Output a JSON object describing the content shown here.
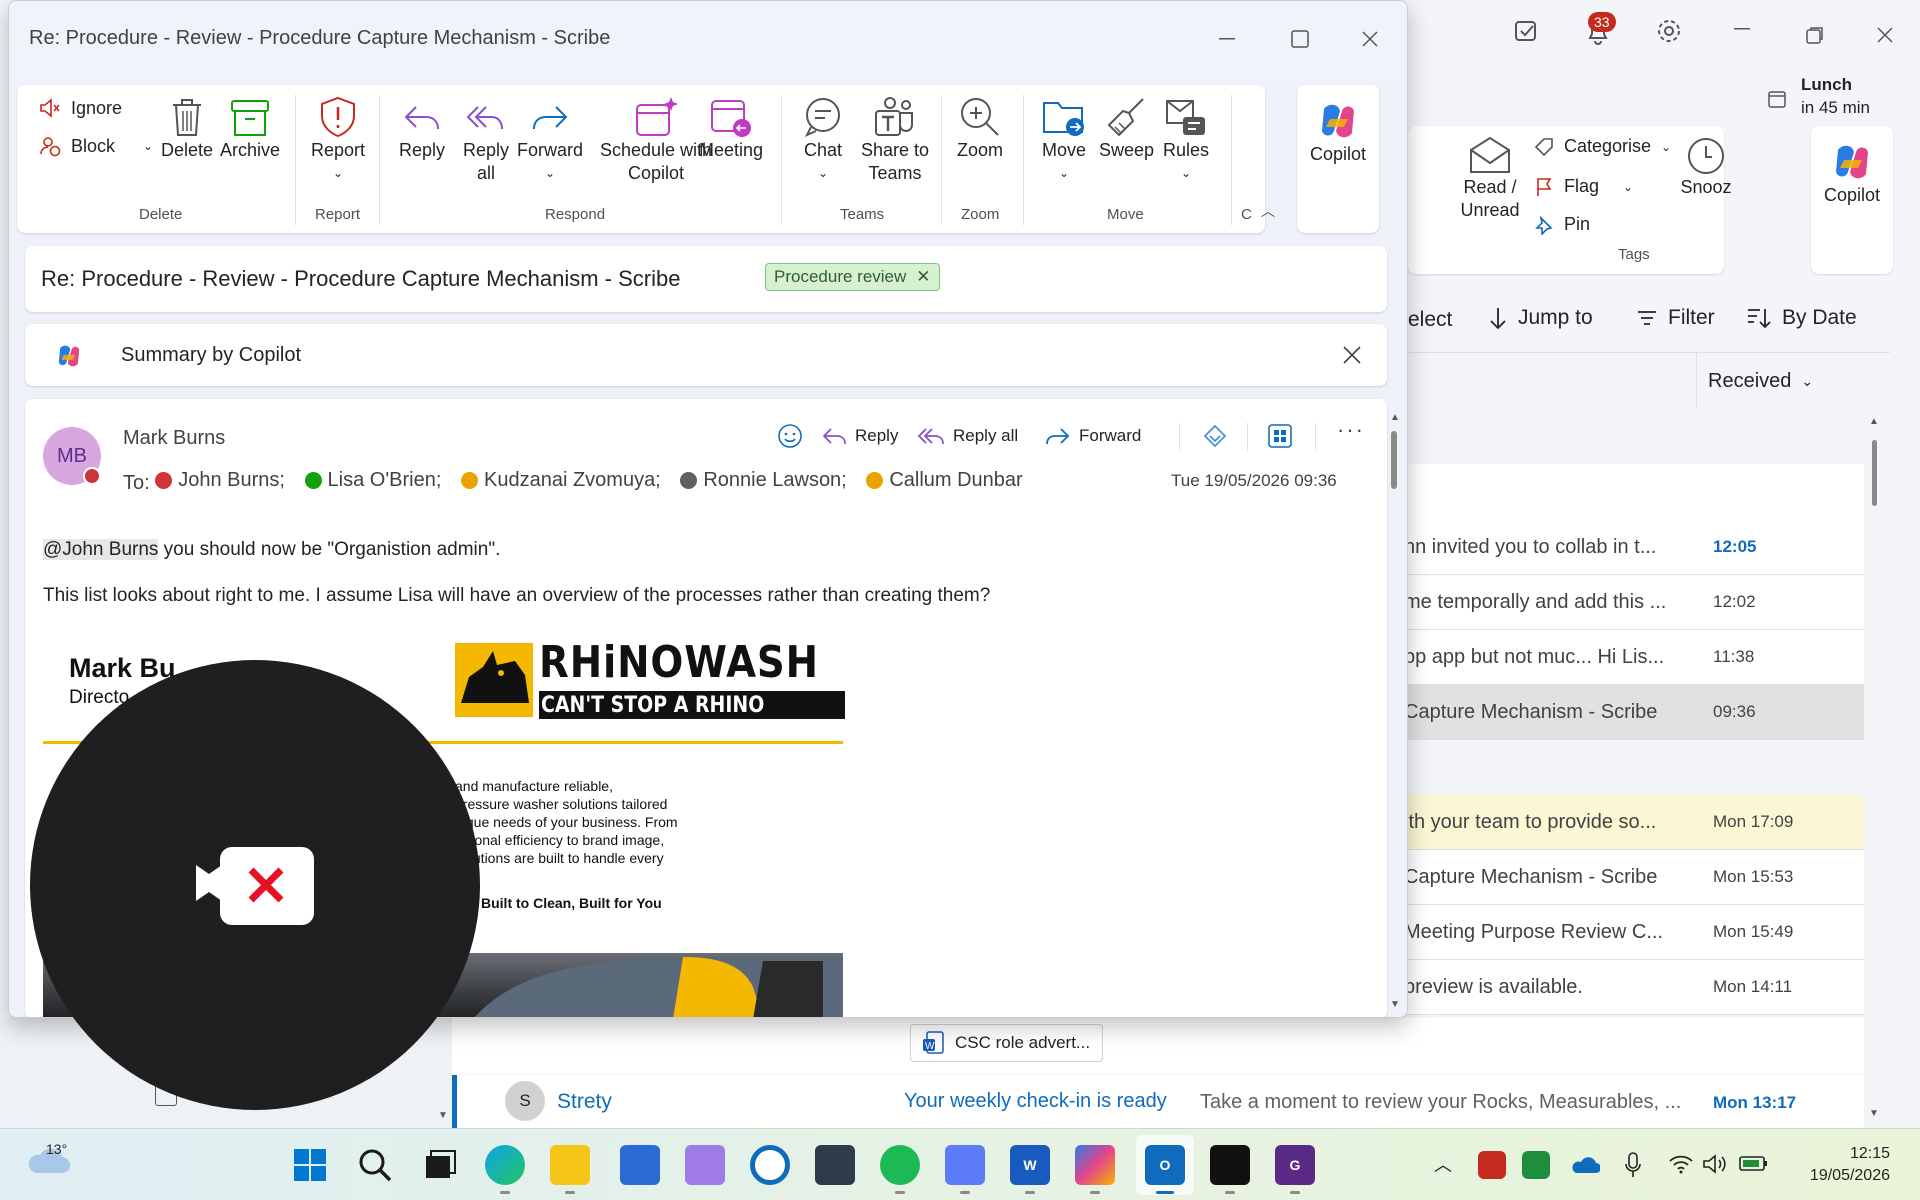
{
  "background": {
    "titlebar": {
      "notification_count": "33"
    },
    "lunch": {
      "title": "Lunch",
      "subtitle": "in 45 min"
    },
    "ribbon": {
      "read_unread": "Read / Unread",
      "categorise": "Categorise",
      "flag": "Flag",
      "pin": "Pin",
      "snooze": "Snooz",
      "tags_group": "Tags",
      "copilot": "Copilot"
    },
    "toolbar": {
      "select": "elect",
      "jump_to": "Jump to",
      "filter": "Filter",
      "by_date": "By Date"
    },
    "sort_label": "Received",
    "mail_rows": [
      {
        "preview": "nn invited you to collab in t...",
        "time": "12:05",
        "unread": true
      },
      {
        "preview": "me temporally and add this ...",
        "time": "12:02"
      },
      {
        "preview": "pp app but not muc...   Hi Lis...",
        "time": "11:38"
      },
      {
        "preview": "Capture Mechanism - Scribe",
        "time": "09:36",
        "selected": true
      },
      {
        "preview": "ith your team to provide so...",
        "time": "Mon 17:09",
        "highlight": true
      },
      {
        "preview": "Capture Mechanism - Scribe",
        "time": "Mon 15:53"
      },
      {
        "preview": " Meeting Purpose Review C...",
        "time": "Mon 15:49"
      },
      {
        "preview": "preview is available.",
        "time": "Mon 14:11"
      }
    ],
    "attachment_chip": "CSC role advert...",
    "strety_row": {
      "avatar": "S",
      "sender": "Strety",
      "subject": "Your weekly check-in is ready",
      "preview": "Take a moment to review your Rocks, Measurables, ...",
      "time": "Mon 13:17"
    }
  },
  "popup": {
    "title": "Re: Procedure - Review - Procedure Capture Mechanism - Scribe",
    "ribbon": {
      "ignore": "Ignore",
      "block": "Block",
      "delete": "Delete",
      "archive": "Archive",
      "delete_group": "Delete",
      "report": "Report",
      "report_group": "Report",
      "reply": "Reply",
      "reply_all": "Reply all",
      "forward": "Forward",
      "schedule_copilot": "Schedule with Copilot",
      "meeting": "Meeting",
      "respond_group": "Respond",
      "chat": "Chat",
      "share_teams": "Share to Teams",
      "teams_group": "Teams",
      "zoom": "Zoom",
      "zoom_group": "Zoom",
      "move": "Move",
      "sweep": "Sweep",
      "rules": "Rules",
      "move_group": "Move",
      "overflow": "C",
      "copilot": "Copilot"
    },
    "subject": "Re: Procedure - Review - Procedure Capture Mechanism - Scribe",
    "tag": "Procedure review",
    "summary_label": "Summary by Copilot",
    "sender": {
      "initials": "MB",
      "name": "Mark Burns"
    },
    "actions": {
      "reply": "Reply",
      "reply_all": "Reply all",
      "forward": "Forward"
    },
    "to_label": "To:",
    "recipients": [
      {
        "name": "John Burns;",
        "status_color": "#d13438"
      },
      {
        "name": "Lisa O'Brien;",
        "status_color": "#13a10e"
      },
      {
        "name": "Kudzanai Zvomuya;",
        "status_color": "#eaa300"
      },
      {
        "name": "Ronnie Lawson;",
        "status_color": "#616161"
      },
      {
        "name": "Callum Dunbar",
        "status_color": "#eaa300"
      }
    ],
    "date": "Tue 19/05/2026 09:36",
    "body": {
      "mention": "@John Burns",
      "line1_rest": " you should now be \"Organistion admin\".",
      "line2": "This list looks about right to me. I assume Lisa will have an overview of the processes rather than creating them?"
    },
    "signature": {
      "name": "Mark Bu",
      "role": "Directo",
      "brand": "RHiNOWASH",
      "brand_tagline": "CAN'T STOP A RHINO",
      "blurb": [
        "and manufacture reliable,",
        " pressure washer solutions tailored",
        "nique needs of your business. From",
        "rational efficiency to brand image,",
        "solutions are built to handle every"
      ],
      "slogan": "Built to Clean, Built for You"
    }
  },
  "taskbar": {
    "weather": "13°",
    "time": "12:15",
    "date": "19/05/2026"
  }
}
